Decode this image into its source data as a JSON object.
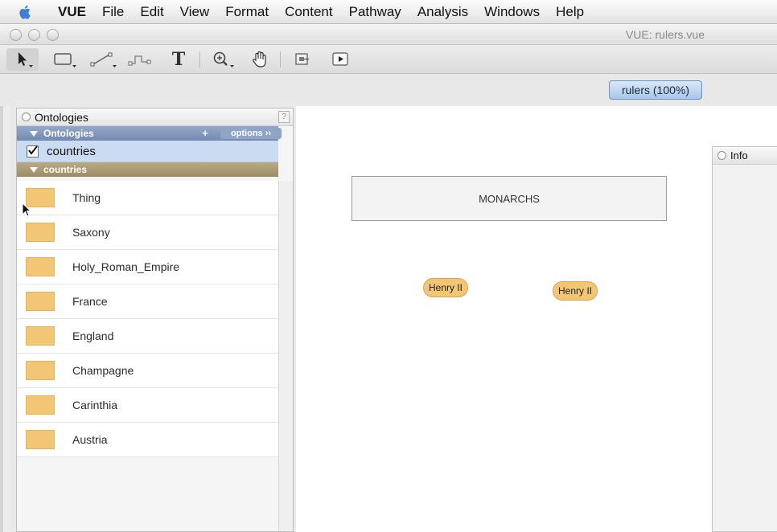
{
  "menubar": {
    "app_name": "VUE",
    "items": [
      "File",
      "Edit",
      "View",
      "Format",
      "Content",
      "Pathway",
      "Analysis",
      "Windows",
      "Help"
    ]
  },
  "window": {
    "title": "VUE: rulers.vue"
  },
  "toolbar": {
    "tools": [
      {
        "name": "selection-tool",
        "icon": "arrow-pointer-icon"
      },
      {
        "name": "node-tool",
        "icon": "rectangle-icon"
      },
      {
        "name": "link-tool",
        "icon": "link-line-icon"
      },
      {
        "name": "curve-link-tool",
        "icon": "curve-link-icon"
      },
      {
        "name": "text-tool",
        "icon": "text-t-icon",
        "label": "T"
      },
      {
        "name": "zoom-tool",
        "icon": "magnifier-icon"
      },
      {
        "name": "pan-tool",
        "icon": "hand-icon"
      },
      {
        "name": "presentation-tool",
        "icon": "presentation-icon"
      },
      {
        "name": "play-tool",
        "icon": "play-icon"
      }
    ]
  },
  "map_tab": {
    "label": "rulers (100%)"
  },
  "ontology_panel": {
    "title": "Ontologies",
    "help": "?",
    "section_label": "Ontologies",
    "add_label": "+",
    "options_label": "options ››",
    "ontology": {
      "label": "countries",
      "checked": true
    },
    "type_section_label": "countries",
    "types": [
      {
        "label": "Thing"
      },
      {
        "label": "Saxony"
      },
      {
        "label": "Holy_Roman_Empire"
      },
      {
        "label": "France"
      },
      {
        "label": "England"
      },
      {
        "label": "Champagne"
      },
      {
        "label": "Carinthia"
      },
      {
        "label": "Austria"
      }
    ],
    "swatch_color": "#f3c676"
  },
  "canvas": {
    "group_node": {
      "label": "MONARCHS"
    },
    "nodes": [
      {
        "label": "Henry II"
      },
      {
        "label": "Henry II"
      }
    ]
  },
  "info_panel": {
    "title": "Info"
  }
}
